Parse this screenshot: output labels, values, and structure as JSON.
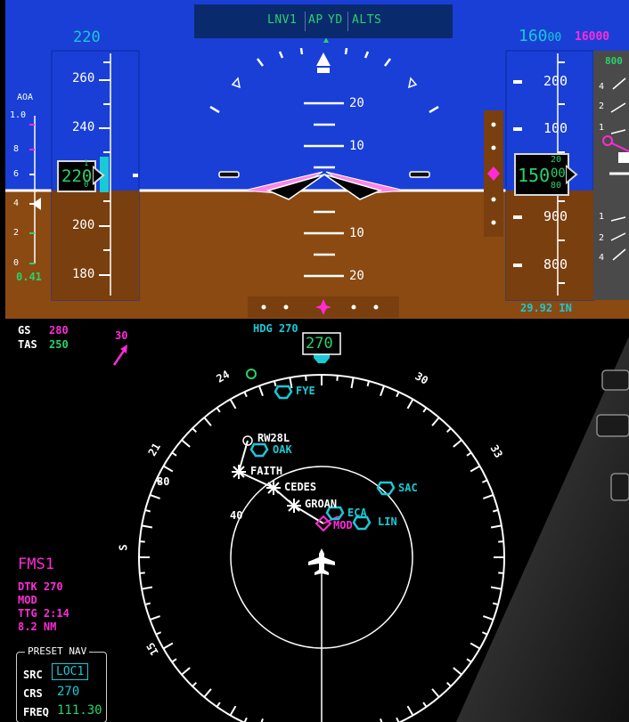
{
  "colors": {
    "sky": "#1a3fd6",
    "ground": "#8a4a12",
    "tape": "#8a4a12",
    "cyan": "#19c9d6",
    "green": "#27d36b",
    "magenta": "#ff2bd6",
    "white": "#ffffff"
  },
  "fma": {
    "lateral": "LNV1",
    "ap": "AP",
    "yd": "YD",
    "vertical": "ALTS"
  },
  "speed": {
    "selected": "220",
    "current": "220",
    "trend_up_digit": "1",
    "trend_down_digit": "0",
    "ticks": [
      "260",
      "240",
      "200",
      "180"
    ]
  },
  "aoa": {
    "title": "AOA",
    "ticks": [
      "1.0",
      "8",
      "6",
      "4",
      "2",
      "0"
    ],
    "value": "0.41"
  },
  "pitch": {
    "up": [
      "20",
      "10"
    ],
    "down": [
      "10",
      "20"
    ]
  },
  "altitude": {
    "selected": "16000",
    "selected_prefix": "160",
    "selected_suffix": "00",
    "preselect": "16000",
    "current_main": "150",
    "current_roll": [
      "20",
      "00",
      "80"
    ],
    "ticks": [
      "200",
      "100",
      "900",
      "800"
    ],
    "baro": "29.92 IN"
  },
  "vsi": {
    "top": "800",
    "ticks": [
      "4",
      "2",
      "1",
      "1",
      "2",
      "4"
    ]
  },
  "nav": {
    "gs_label": "GS",
    "gs_value": "280",
    "tas_label": "TAS",
    "tas_value": "250",
    "wind_dir": "30",
    "hdg_label": "HDG",
    "hdg_value": "270",
    "heading": "270"
  },
  "compass": {
    "labels": [
      "24",
      "30",
      "33",
      "21",
      "S",
      "15"
    ]
  },
  "ranges": {
    "outer": "80",
    "inner": "40"
  },
  "waypoints": {
    "rw": "RW28L",
    "oak": "OAK",
    "faith": "FAITH",
    "cedes": "CEDES",
    "groan": "GROAN",
    "mod": "MOD",
    "fye": "FYE",
    "sac": "SAC",
    "eca": "ECA",
    "lin": "LIN"
  },
  "fms": {
    "source": "FMS1",
    "dtk": "DTK 270",
    "wpt": "MOD",
    "ttg": "TTG 2:14",
    "dist": "8.2 NM"
  },
  "preset": {
    "title": "PRESET NAV",
    "src_label": "SRC",
    "src_value": "LOC1",
    "crs_label": "CRS",
    "crs_value": "270",
    "freq_label": "FREQ",
    "freq_value": "111.30"
  }
}
